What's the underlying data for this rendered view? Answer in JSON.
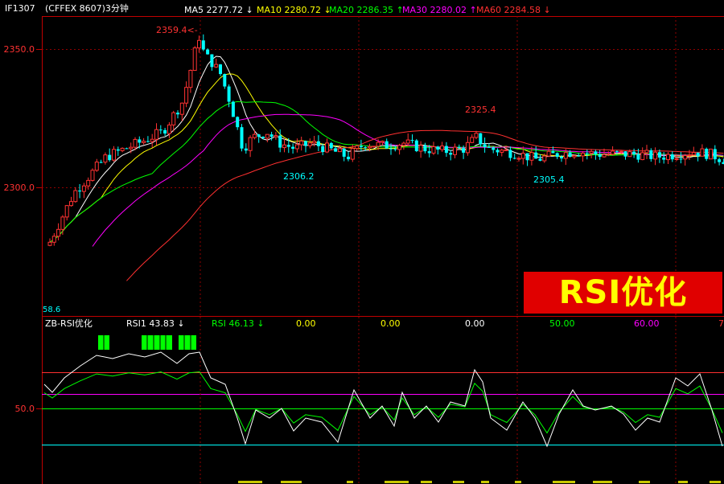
{
  "header": {
    "symbol": "IF1307",
    "exchange": "(CFFEX 8607)3分钟",
    "ma": [
      {
        "label": "MA5 2277.72 ↓",
        "color": "#ffffff"
      },
      {
        "label": "MA10 2280.72 ↓",
        "color": "#ffff00"
      },
      {
        "label": "MA20 2286.35 ↑",
        "color": "#00ff00"
      },
      {
        "label": "MA30 2280.02 ↑",
        "color": "#ff00ff"
      },
      {
        "label": "MA60 2284.58 ↓",
        "color": "#ff3030"
      }
    ]
  },
  "price_axis": {
    "ticks": [
      "2350.0",
      "2300.0"
    ],
    "low_label": "58.6"
  },
  "annotations": {
    "high1": "2359.4",
    "low1": "2306.2",
    "high2": "2325.4",
    "low2": "2305.4"
  },
  "indicator": {
    "name": "ZB-RSI优化",
    "values": [
      {
        "label": "RSI1  43.83 ↓",
        "color": "#ffffff"
      },
      {
        "label": "RSI  46.13 ↓",
        "color": "#00ff00"
      },
      {
        "label": "0.00",
        "color": "#ffff00"
      },
      {
        "label": "0.00",
        "color": "#ffff00"
      },
      {
        "label": "0.00",
        "color": "#ffffff"
      },
      {
        "label": "50.00",
        "color": "#00ff00"
      },
      {
        "label": "60.00",
        "color": "#ff00ff"
      },
      {
        "label": "7",
        "color": "#ff3030"
      }
    ],
    "axis_tick": "50.0"
  },
  "banner": {
    "text": "RSI优化"
  },
  "colors": {
    "up": "#ff3232",
    "down": "#00ffff",
    "axis": "#c00000",
    "grid": "#800000"
  }
}
